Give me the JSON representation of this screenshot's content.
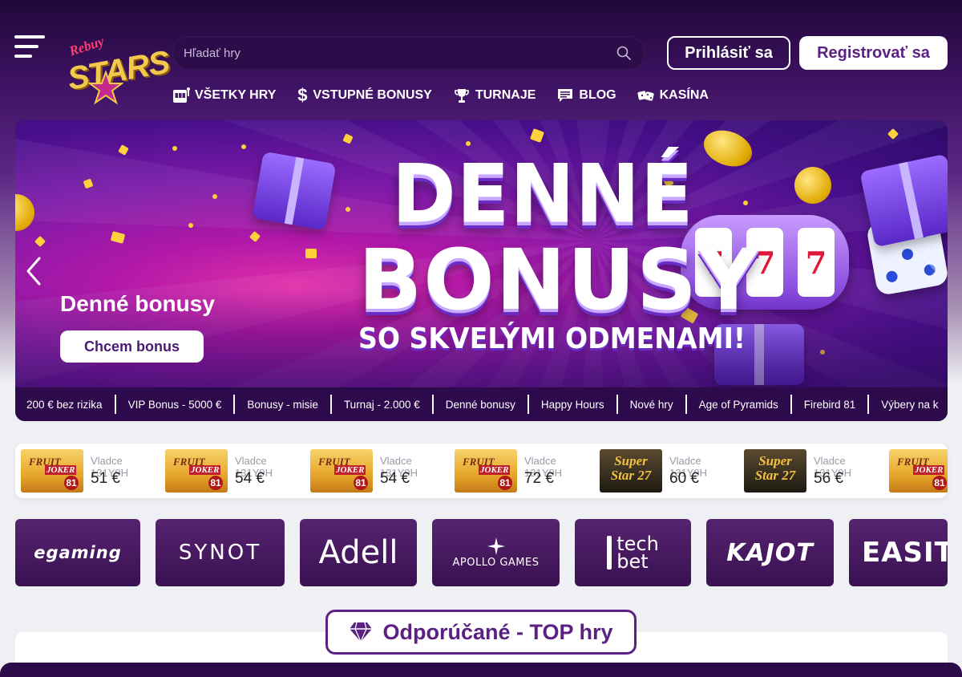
{
  "header": {
    "logo_text_top": "Rebuy",
    "logo_text_main": "STARS",
    "search_placeholder": "Hľadať hry",
    "login_label": "Prihlásiť sa",
    "register_label": "Registrovať sa"
  },
  "nav": {
    "items": [
      {
        "label": "VŠETKY HRY",
        "icon": "slot-machine-icon"
      },
      {
        "label": "VSTUPNÉ BONUSY",
        "icon": "dollar-icon"
      },
      {
        "label": "TURNAJE",
        "icon": "trophy-icon"
      },
      {
        "label": "BLOG",
        "icon": "message-icon"
      },
      {
        "label": "KASÍNA",
        "icon": "dice-icon"
      }
    ]
  },
  "banner": {
    "headline_line1": "DENNÉ",
    "headline_line2": "BONUSY",
    "headline_line3": "SO SKVELÝMI ODMENAMI!",
    "title": "Denné bonusy",
    "cta": "Chcem bonus",
    "slot_symbols": [
      "7",
      "7",
      "7"
    ],
    "tabs": [
      "200 € bez rizika",
      "VIP Bonus - 5000 €",
      "Bonusy - misie",
      "Turnaj - 2.000 €",
      "Denné bonusy",
      "Happy Hours",
      "Nové hry",
      "Age of Pyramids",
      "Firebird 81",
      "Výbery na k"
    ]
  },
  "winners": [
    {
      "game": "fruit",
      "thumb_line1": "FRUIT",
      "thumb_line2": "JOKER",
      "thumb_badge": "81",
      "name": "Vladce 131Y9H",
      "amount": "51 €"
    },
    {
      "game": "fruit",
      "thumb_line1": "FRUIT",
      "thumb_line2": "JOKER",
      "thumb_badge": "81",
      "name": "Vladce 131Y9H",
      "amount": "54 €"
    },
    {
      "game": "fruit",
      "thumb_line1": "FRUIT",
      "thumb_line2": "JOKER",
      "thumb_badge": "81",
      "name": "Vladce 131Y9H",
      "amount": "54 €"
    },
    {
      "game": "fruit",
      "thumb_line1": "FRUIT",
      "thumb_line2": "JOKER",
      "thumb_badge": "81",
      "name": "Vladce 131Y9H",
      "amount": "72 €"
    },
    {
      "game": "super",
      "thumb_line1": "Super",
      "thumb_line2": "Star 27",
      "name": "Vladce 131Y9H",
      "amount": "60 €"
    },
    {
      "game": "super",
      "thumb_line1": "Super",
      "thumb_line2": "Star 27",
      "name": "Vladce 131Y9H",
      "amount": "56 €"
    },
    {
      "game": "fruit",
      "thumb_line1": "FRUIT",
      "thumb_line2": "JOKER",
      "thumb_badge": "81"
    }
  ],
  "providers": [
    {
      "label": "egaming"
    },
    {
      "label": "SYNOT"
    },
    {
      "label": "Adell"
    },
    {
      "label": "APOLLO GAMES"
    },
    {
      "label_top": "tech",
      "label_bottom": "bet"
    },
    {
      "label": "KAJOT"
    },
    {
      "label": "EASIT"
    }
  ],
  "featured": {
    "title": "Odporúčané - TOP hry",
    "icon": "diamond-icon"
  },
  "colors": {
    "accent": "#5b2182",
    "header_bg": "#3c1160",
    "tab_bar": "#2c0a4c",
    "coin": "#ffd23c"
  }
}
